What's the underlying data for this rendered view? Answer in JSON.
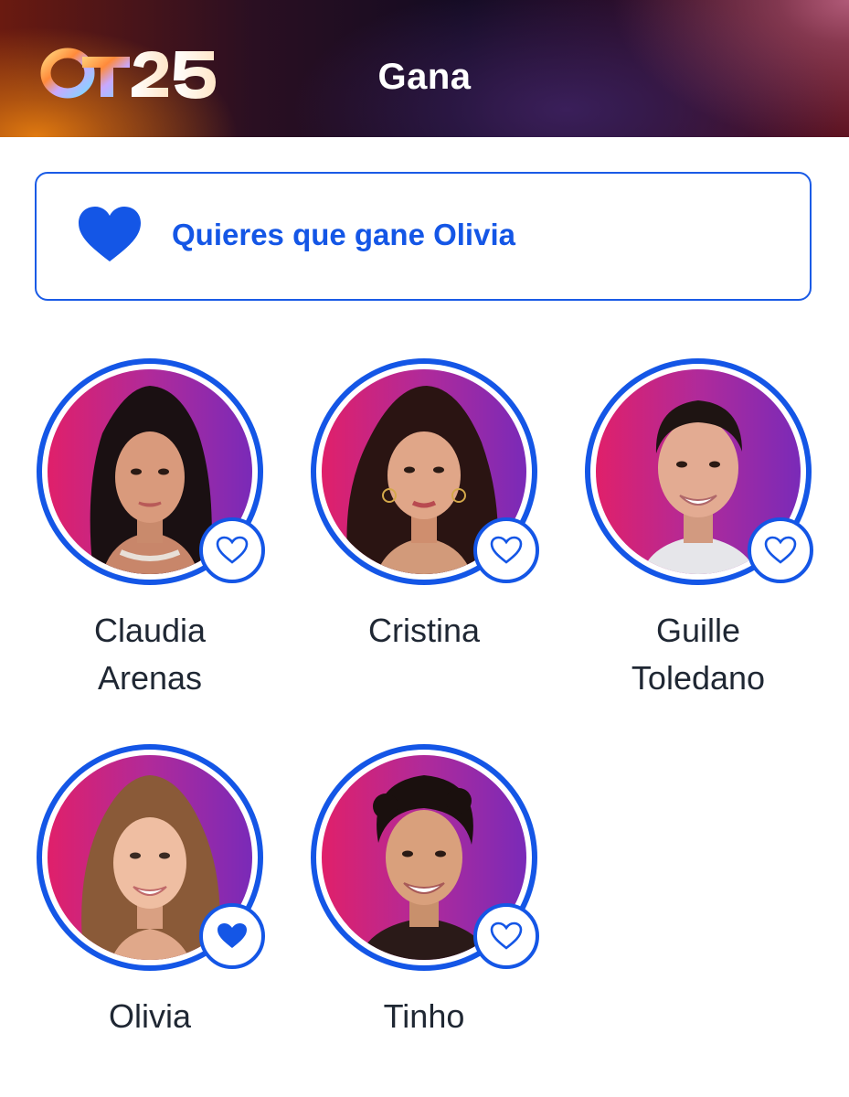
{
  "header": {
    "logo": "OT25",
    "title": "Gana"
  },
  "wish": {
    "icon": "heart-filled-icon",
    "text": "Quieres que gane Olivia"
  },
  "colors": {
    "accent": "#1456e6",
    "text": "#1f2733",
    "background": "#ffffff"
  },
  "contestants": [
    {
      "name_line1": "Claudia",
      "name_line2": "Arenas",
      "favorite": false
    },
    {
      "name_line1": "Cristina",
      "name_line2": "",
      "favorite": false
    },
    {
      "name_line1": "Guille",
      "name_line2": "Toledano",
      "favorite": false
    },
    {
      "name_line1": "Olivia",
      "name_line2": "",
      "favorite": true
    },
    {
      "name_line1": "Tinho",
      "name_line2": "",
      "favorite": false
    }
  ]
}
